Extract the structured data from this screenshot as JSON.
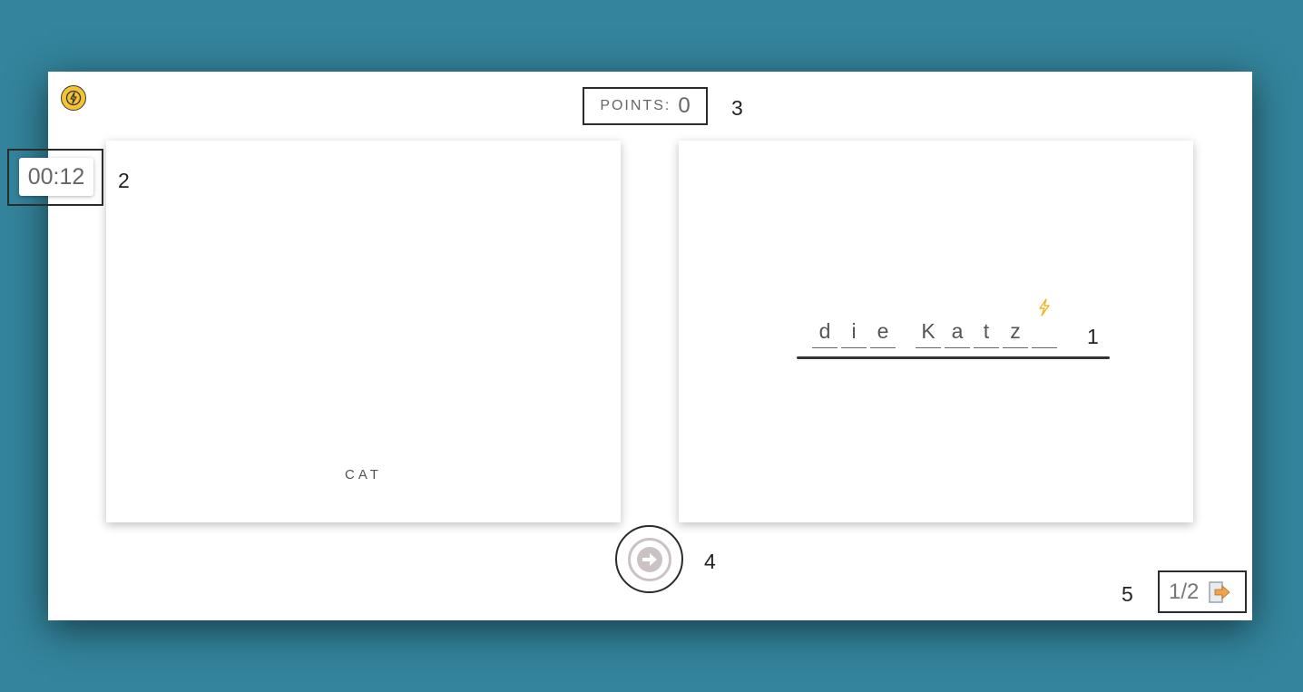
{
  "header": {
    "points_label": "POINTS:",
    "points_value": "0"
  },
  "timer": {
    "value": "00:12"
  },
  "prompt_card": {
    "word": "CAT"
  },
  "answer_card": {
    "letters": [
      "d",
      "i",
      "e",
      "",
      "K",
      "a",
      "t",
      "z",
      ""
    ],
    "hint_icon": "lightning-icon"
  },
  "footer": {
    "progress": "1/2"
  },
  "annotations": {
    "a1": "1",
    "a2": "2",
    "a3": "3",
    "a4": "4",
    "a5": "5"
  },
  "colors": {
    "background": "#33849c",
    "accent_yellow": "#f3c335",
    "button_ring": "#cbc3c3",
    "exit_orange": "#f0a54a"
  }
}
